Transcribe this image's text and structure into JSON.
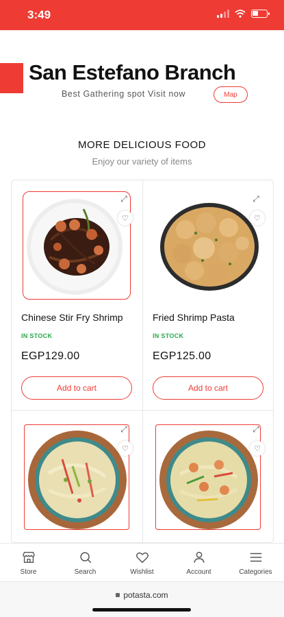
{
  "status": {
    "time": "3:49"
  },
  "header": {
    "title": "San Estefano Branch",
    "tagline": "Best Gathering spot Visit now",
    "map_label": "Map"
  },
  "section": {
    "title": "MORE DELICIOUS FOOD",
    "subtitle": "Enjoy our variety of items"
  },
  "products": [
    {
      "name": "Chinese Stir Fry Shrimp",
      "stock": "IN STOCK",
      "price": "EGP129.00",
      "cart_label": "Add to cart"
    },
    {
      "name": "Fried Shrimp Pasta",
      "stock": "IN STOCK",
      "price": "EGP125.00",
      "cart_label": "Add to cart"
    },
    {
      "name": "",
      "stock": "",
      "price": "",
      "cart_label": ""
    },
    {
      "name": "",
      "stock": "",
      "price": "",
      "cart_label": ""
    }
  ],
  "nav": [
    {
      "label": "Store",
      "icon": "store-icon"
    },
    {
      "label": "Search",
      "icon": "search-icon"
    },
    {
      "label": "Wishlist",
      "icon": "heart-icon"
    },
    {
      "label": "Account",
      "icon": "user-icon"
    },
    {
      "label": "Categories",
      "icon": "menu-icon"
    }
  ],
  "browser": {
    "url": "potasta.com"
  },
  "colors": {
    "accent": "#ee3b33",
    "stock": "#2aa84a"
  }
}
